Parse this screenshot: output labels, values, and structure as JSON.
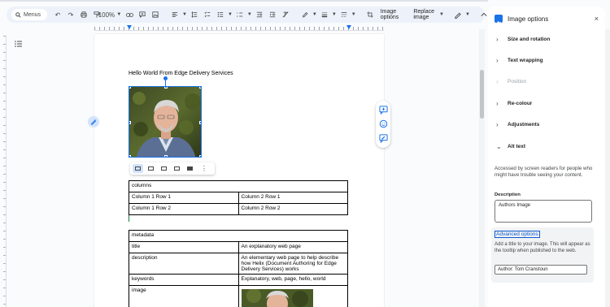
{
  "toolbar": {
    "menus_label": "Menus",
    "zoom": "100%",
    "image_options_label": "Image options",
    "replace_image_label": "Replace image"
  },
  "document": {
    "heading_text": "Hello World From Edge Delivery Services",
    "columns_table": {
      "rows": [
        [
          "columns",
          ""
        ],
        [
          "Column 1 Row 1",
          "Column 2 Row 1"
        ],
        [
          "Column 1 Row 2",
          "Column 2 Row 2"
        ]
      ]
    },
    "metadata_table": {
      "rows": [
        [
          "metadata",
          ""
        ],
        [
          "title",
          "An explanatory web page"
        ],
        [
          "description",
          "An elementary web page to help describe how Helix (Document Authoring for Edge Delivery Services) works"
        ],
        [
          "keywords",
          "Explanatory, web, page, hello, world"
        ],
        [
          "image",
          ""
        ]
      ]
    }
  },
  "panel": {
    "title": "Image options",
    "close_label": "×",
    "sections": [
      {
        "label": "Size and rotation",
        "enabled": true,
        "expanded": false
      },
      {
        "label": "Text wrapping",
        "enabled": true,
        "expanded": false
      },
      {
        "label": "Position",
        "enabled": false,
        "expanded": false
      },
      {
        "label": "Re-colour",
        "enabled": true,
        "expanded": false
      },
      {
        "label": "Adjustments",
        "enabled": true,
        "expanded": false
      },
      {
        "label": "Alt text",
        "enabled": true,
        "expanded": true
      }
    ],
    "alt_text": {
      "help": "Accessed by screen readers for people who might have trouble seeing your content.",
      "description_label": "Description",
      "description_value": "Authors Image",
      "advanced_label": "Advanced options",
      "advanced_help": "Add a title to your image. This will appear as the tooltip when published to the web.",
      "title_value": "Author: Tom Cranstoun"
    }
  },
  "colors": {
    "accent": "#1a73e8",
    "toolbar_bg": "#edf2fa",
    "link": "#0b57d0"
  }
}
